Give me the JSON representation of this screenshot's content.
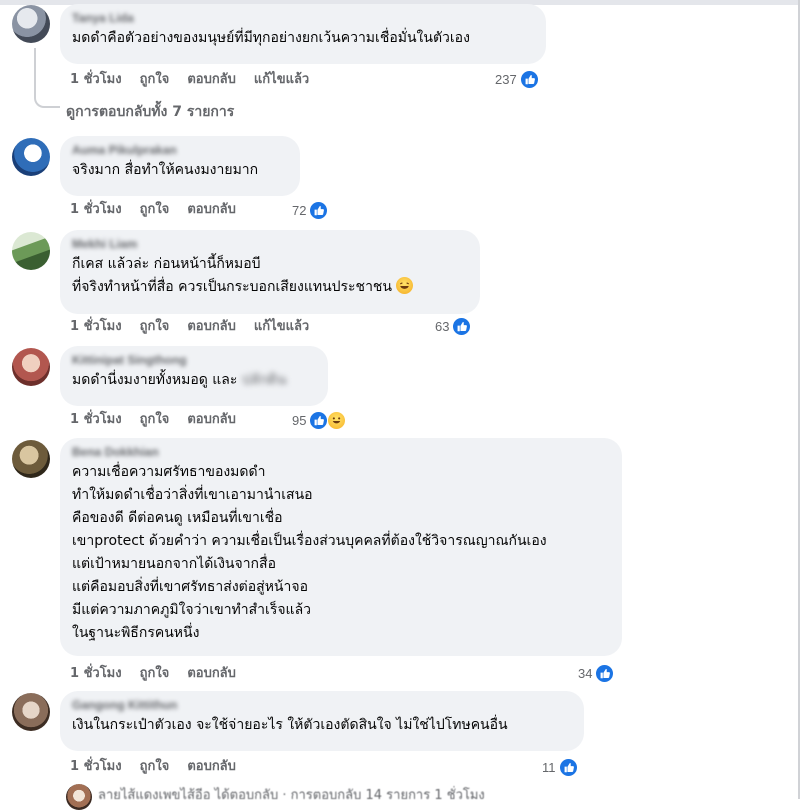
{
  "comments": [
    {
      "author": "Tanya Lida",
      "lines": [
        "มดดำคือตัวอย่างของมนุษย์ที่มีทุกอย่างยกเว้นความเชื่อมั่นในตัวเอง"
      ],
      "time": "1 ชั่วโมง",
      "like": "ถูกใจ",
      "reply": "ตอบกลับ",
      "edited": "แก้ไขแล้ว",
      "reactions": "237"
    },
    {
      "author": "Auma Pikulprakan",
      "lines": [
        "จริงมาก สื่อทำให้คนงมงายมาก"
      ],
      "time": "1 ชั่วโมง",
      "like": "ถูกใจ",
      "reply": "ตอบกลับ",
      "reactions": "72"
    },
    {
      "author": "Mekhi Liam",
      "lines": [
        "กีเคส แล้วล่ะ ก่อนหน้านี้ก็หมอบี",
        "ที่จริงทำหน้าที่สื่อ ควรเป็นกระบอกเสียงแทนประชาชน"
      ],
      "time": "1 ชั่วโมง",
      "like": "ถูกใจ",
      "reply": "ตอบกลับ",
      "edited": "แก้ไขแล้ว",
      "reactions": "63"
    },
    {
      "author": "Kittinipat Singthong",
      "lines": [
        "มดดำนี่งมงายทั้งหมอดู และ"
      ],
      "blurred_tail": "ปลักดิน",
      "time": "1 ชั่วโมง",
      "like": "ถูกใจ",
      "reply": "ตอบกลับ",
      "reactions": "95"
    },
    {
      "author": "Bena Dokkhian",
      "lines": [
        "ความเชื่อความศรัทธาของมดดำ",
        "ทำให้มดดำเชื่อว่าสิ่งที่เขาเอามานำเสนอ",
        "คือของดี ดีต่อคนดู เหมือนที่เขาเชื่อ",
        "เขาprotect ด้วยคำว่า ความเชื่อเป็นเรื่องส่วนบุคคลที่ต้องใช้วิจารณญาณกันเอง",
        "แต่เป้าหมายนอกจากได้เงินจากสื่อ",
        "แต่คือมอบสิ่งที่เขาศรัทธาส่งต่อสู่หน้าจอ",
        "มีแต่ความภาคภูมิใจว่าเขาทำสำเร็จแล้ว",
        "ในฐานะพิธีกรคนหนึ่ง"
      ],
      "time": "1 ชั่วโมง",
      "like": "ถูกใจ",
      "reply": "ตอบกลับ",
      "reactions": "34"
    },
    {
      "author": "Gangong Kittithun",
      "lines": [
        "เงินในกระเป๋าตัวเอง จะใช้จ่ายอะไร ให้ตัวเองตัดสินใจ ไม่ใช่ไปโทษคนอื่น"
      ],
      "time": "1 ชั่วโมง",
      "like": "ถูกใจ",
      "reply": "ตอบกลับ",
      "reactions": "11"
    }
  ],
  "view_replies": "ดูการตอบกลับทั้ง 7 รายการ",
  "bottom_partial": "ลายไส้แดงเพขไส้อีอ ได้ตอบกลับ · การตอบกลับ 14 รายการ 1 ชั่วโมง",
  "colors": {
    "like_blue": "#1b74e4",
    "bubble": "#f0f2f5",
    "meta_gray": "#65676b"
  }
}
